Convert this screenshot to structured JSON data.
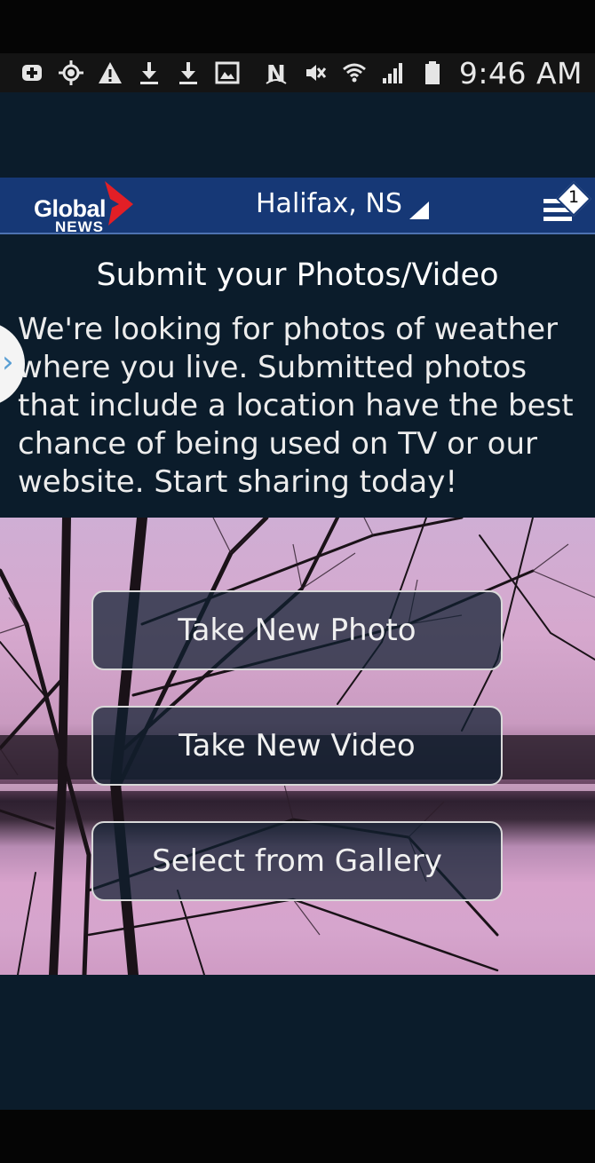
{
  "status_bar": {
    "time": "9:46 AM",
    "left_icons": [
      "add-box-icon",
      "gps-icon",
      "warning-icon",
      "download-icon",
      "download-icon",
      "image-icon"
    ],
    "right_icons": [
      "nfc-icon",
      "mute-icon",
      "wifi-icon",
      "signal-icon",
      "battery-icon"
    ]
  },
  "header": {
    "logo_line1": "Global",
    "logo_line2": "NEWS",
    "location": "Halifax, NS",
    "notification_count": "1",
    "colors": {
      "bar": "#163876",
      "logo_red": "#e21f26"
    }
  },
  "content": {
    "title": "Submit your Photos/Video",
    "description": "We're looking for photos of weather where you live. Submitted photos that include a location have the best chance of being used on TV or our website. Start sharing today!",
    "side_tab_glyph": "›"
  },
  "actions": {
    "take_photo": "Take New Photo",
    "take_video": "Take New Video",
    "gallery": "Select from Gallery"
  }
}
